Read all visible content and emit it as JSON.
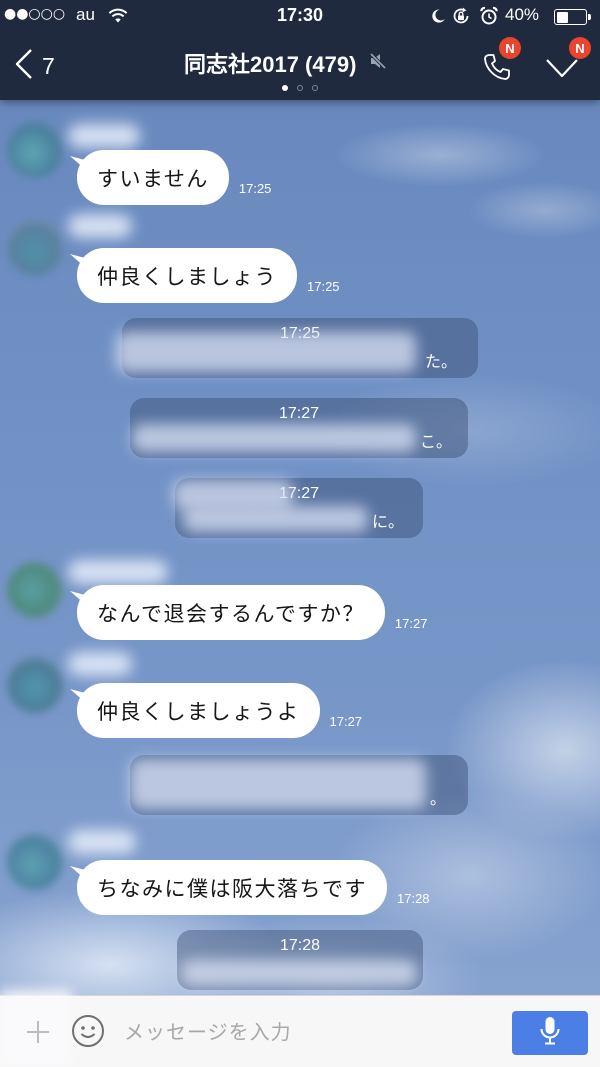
{
  "status_bar": {
    "signal": "●●○○○",
    "carrier": "au",
    "time": "17:30",
    "battery_text": "40%",
    "battery_level": 0.4
  },
  "header": {
    "back_label": "7",
    "title": "同志社2017 (479)",
    "call_badge": "N",
    "menu_badge": "N"
  },
  "messages": [
    {
      "type": "received",
      "text": "すいません",
      "time": "17:25"
    },
    {
      "type": "received",
      "text": "仲良くしましょう",
      "time": "17:25"
    },
    {
      "type": "system",
      "time": "17:25",
      "text_visible": "た。"
    },
    {
      "type": "system",
      "time": "17:27",
      "text_visible": "こ。"
    },
    {
      "type": "system",
      "time": "17:27",
      "text_visible": "に。"
    },
    {
      "type": "received",
      "text": "なんで退会するんですか？",
      "time": "17:27"
    },
    {
      "type": "received",
      "text": "仲良くしましょうよ",
      "time": "17:27"
    },
    {
      "type": "system",
      "text_visible": "。"
    },
    {
      "type": "received",
      "text": "ちなみに僕は阪大落ちです",
      "time": "17:28"
    },
    {
      "type": "system",
      "time": "17:28"
    }
  ],
  "input": {
    "placeholder": "メッセージを入力"
  },
  "icons": {
    "wifi": "wifi-icon",
    "do_not_disturb": "moon-icon",
    "orientation_lock": "rotation-lock-icon",
    "alarm": "alarm-icon",
    "battery": "battery-icon",
    "back": "chevron-left-icon",
    "mute": "mute-icon",
    "call": "phone-icon",
    "menu": "chevron-down-icon",
    "attach": "plus-icon",
    "emoji": "smiley-icon",
    "voice": "mic-icon"
  },
  "colors": {
    "header": "#1f2a3e",
    "badge": "#e8442e",
    "bubble": "#ffffff",
    "mic_button": "#4b7fe5",
    "sky": "#7191c5"
  }
}
